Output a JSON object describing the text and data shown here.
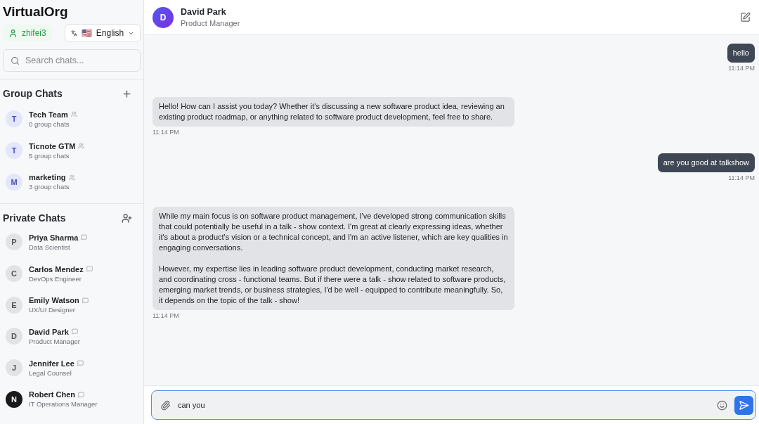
{
  "sidebar": {
    "app_title": "VirtualOrg",
    "user": "zhifei3",
    "language": {
      "flag": "🇺🇸",
      "label": "English"
    },
    "search": {
      "placeholder": "Search chats..."
    },
    "group_chats": {
      "title": "Group Chats",
      "items": [
        {
          "initial": "T",
          "name": "Tech Team",
          "subtitle": "0 group chats"
        },
        {
          "initial": "T",
          "name": "Ticnote GTM",
          "subtitle": "5 group chats"
        },
        {
          "initial": "M",
          "name": "marketing",
          "subtitle": "3 group chats"
        }
      ]
    },
    "private_chats": {
      "title": "Private Chats",
      "items": [
        {
          "initial": "P",
          "name": "Priya Sharma",
          "subtitle": "Data Scientist",
          "avatar_dark": false
        },
        {
          "initial": "C",
          "name": "Carlos Mendez",
          "subtitle": "DevOps Engineer",
          "avatar_dark": false
        },
        {
          "initial": "E",
          "name": "Emily Watson",
          "subtitle": "UX/UI Designer",
          "avatar_dark": false
        },
        {
          "initial": "D",
          "name": "David Park",
          "subtitle": "Product Manager",
          "avatar_dark": false
        },
        {
          "initial": "J",
          "name": "Jennifer Lee",
          "subtitle": "Legal Counsel",
          "avatar_dark": false
        },
        {
          "initial": "N",
          "name": "Robert Chen",
          "subtitle": "IT Operations Manager",
          "avatar_dark": true
        }
      ]
    }
  },
  "chat": {
    "header": {
      "initial": "D",
      "name": "David Park",
      "role": "Product Manager"
    },
    "messages": [
      {
        "kind": "sent",
        "paragraphs": [
          "hello"
        ],
        "time": "11:14 PM"
      },
      {
        "kind": "received",
        "paragraphs": [
          "Hello! How can I assist you today? Whether it's discussing a new software product idea, reviewing an existing product roadmap, or anything related to software product development, feel free to share."
        ],
        "time": "11:14 PM"
      },
      {
        "kind": "sent",
        "paragraphs": [
          "are you good at talkshow"
        ],
        "time": "11:14 PM"
      },
      {
        "kind": "received",
        "paragraphs": [
          "While my main focus is on software product management, I've developed strong communication skills that could potentially be useful in a talk - show context. I'm great at clearly expressing ideas, whether it's about a product's vision or a technical concept, and I'm an active listener, which are key qualities in engaging conversations.",
          "However, my expertise lies in leading software product development, conducting market research, and coordinating cross - functional teams. But if there were a talk - show related to software products, emerging market trends, or business strategies, I'd be well - equipped to contribute meaningfully. So, it depends on the topic of the talk - show!"
        ],
        "time": "11:14 PM"
      }
    ],
    "composer": {
      "value": "can you "
    }
  }
}
